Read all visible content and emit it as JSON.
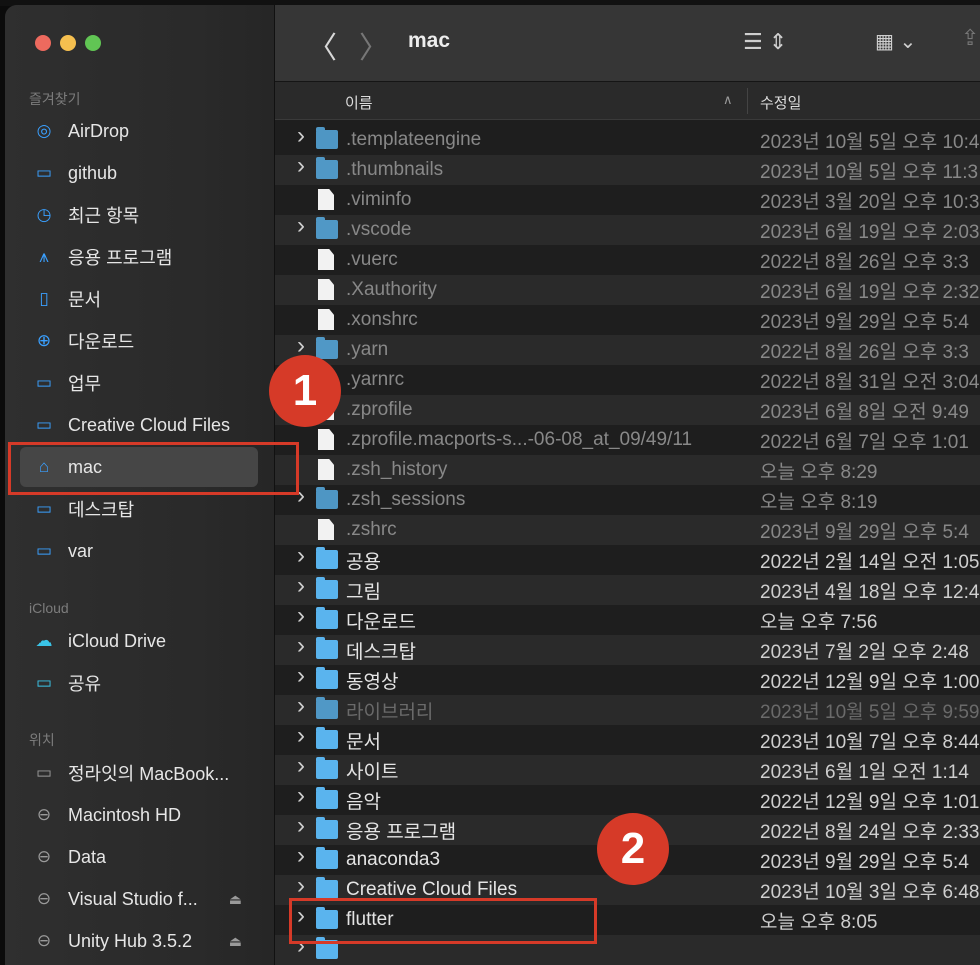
{
  "window": {
    "title": "mac"
  },
  "sidebar": {
    "favorites_header": "즐겨찾기",
    "favorites": [
      {
        "label": "AirDrop",
        "icon": "airdrop-icon"
      },
      {
        "label": "github",
        "icon": "folder-icon"
      },
      {
        "label": "최근 항목",
        "icon": "clock-icon"
      },
      {
        "label": "응용 프로그램",
        "icon": "applications-icon"
      },
      {
        "label": "문서",
        "icon": "document-icon"
      },
      {
        "label": "다운로드",
        "icon": "download-icon"
      },
      {
        "label": "업무",
        "icon": "folder-icon"
      },
      {
        "label": "Creative Cloud Files",
        "icon": "folder-icon"
      },
      {
        "label": "mac",
        "icon": "home-icon",
        "selected": true
      },
      {
        "label": "데스크탑",
        "icon": "desktop-icon"
      },
      {
        "label": "var",
        "icon": "folder-icon"
      }
    ],
    "icloud_header": "iCloud",
    "icloud": [
      {
        "label": "iCloud Drive",
        "icon": "cloud-icon"
      },
      {
        "label": "공유",
        "icon": "shared-folder-icon"
      }
    ],
    "locations_header": "위치",
    "locations": [
      {
        "label": "정라잇의 MacBook...",
        "icon": "laptop-icon"
      },
      {
        "label": "Macintosh HD",
        "icon": "disk-icon"
      },
      {
        "label": "Data",
        "icon": "disk-icon"
      },
      {
        "label": "Visual Studio f...",
        "icon": "disk-icon",
        "eject": true
      },
      {
        "label": "Unity Hub 3.5.2",
        "icon": "disk-icon",
        "eject": true
      }
    ]
  },
  "columns": {
    "name": "이름",
    "modified": "수정일"
  },
  "files": [
    {
      "name": ".templateengine",
      "date": "2023년 10월 5일 오후 10:4",
      "folder": true,
      "hidden": true
    },
    {
      "name": ".thumbnails",
      "date": "2023년 10월 5일 오후 11:3",
      "folder": true,
      "hidden": true
    },
    {
      "name": ".viminfo",
      "date": "2023년 3월 20일 오후 10:3",
      "folder": false,
      "hidden": true
    },
    {
      "name": ".vscode",
      "date": "2023년 6월 19일 오후 2:03",
      "folder": true,
      "hidden": true
    },
    {
      "name": ".vuerc",
      "date": "2022년 8월 26일 오후 3:3",
      "folder": false,
      "hidden": true
    },
    {
      "name": ".Xauthority",
      "date": "2023년 6월 19일 오후 2:32",
      "folder": false,
      "hidden": true
    },
    {
      "name": ".xonshrc",
      "date": "2023년 9월 29일 오후 5:4",
      "folder": false,
      "hidden": true
    },
    {
      "name": ".yarn",
      "date": "2022년 8월 26일 오후 3:3",
      "folder": true,
      "hidden": true
    },
    {
      "name": ".yarnrc",
      "date": "2022년 8월 31일 오전 3:04",
      "folder": false,
      "hidden": true
    },
    {
      "name": ".zprofile",
      "date": "2023년 6월 8일 오전 9:49",
      "folder": false,
      "hidden": true
    },
    {
      "name": ".zprofile.macports-s...-06-08_at_09/49/11",
      "date": "2022년 6월 7일 오후 1:01",
      "folder": false,
      "hidden": true
    },
    {
      "name": ".zsh_history",
      "date": "오늘 오후 8:29",
      "folder": false,
      "hidden": true
    },
    {
      "name": ".zsh_sessions",
      "date": "오늘 오후 8:19",
      "folder": true,
      "hidden": true
    },
    {
      "name": ".zshrc",
      "date": "2023년 9월 29일 오후 5:4",
      "folder": false,
      "hidden": true
    },
    {
      "name": "공용",
      "date": "2022년 2월 14일 오전 1:05",
      "folder": true
    },
    {
      "name": "그림",
      "date": "2023년 4월 18일 오후 12:4",
      "folder": true
    },
    {
      "name": "다운로드",
      "date": "오늘 오후 7:56",
      "folder": true
    },
    {
      "name": "데스크탑",
      "date": "2023년 7월 2일 오후 2:48",
      "folder": true
    },
    {
      "name": "동영상",
      "date": "2022년 12월 9일 오후 1:00",
      "folder": true
    },
    {
      "name": "라이브러리",
      "date": "2023년 10월 5일 오후 9:59",
      "folder": true,
      "dim": true
    },
    {
      "name": "문서",
      "date": "2023년 10월 7일 오후 8:44",
      "folder": true
    },
    {
      "name": "사이트",
      "date": "2023년 6월 1일 오전 1:14",
      "folder": true
    },
    {
      "name": "음악",
      "date": "2022년 12월 9일 오후 1:01",
      "folder": true
    },
    {
      "name": "응용 프로그램",
      "date": "2022년 8월 24일 오후 2:33",
      "folder": true
    },
    {
      "name": "anaconda3",
      "date": "2023년 9월 29일 오후 5:4",
      "folder": true
    },
    {
      "name": "Creative Cloud Files",
      "date": "2023년 10월 3일 오후 6:48",
      "folder": true
    },
    {
      "name": "flutter",
      "date": "오늘 오후 8:05",
      "folder": true
    },
    {
      "name": "",
      "date": "",
      "folder": true
    }
  ],
  "annotations": [
    {
      "label": "1"
    },
    {
      "label": "2"
    }
  ],
  "colors": {
    "accent": "#3aa0ff",
    "annotation": "#d63a28",
    "folder": "#5ab4ee"
  }
}
